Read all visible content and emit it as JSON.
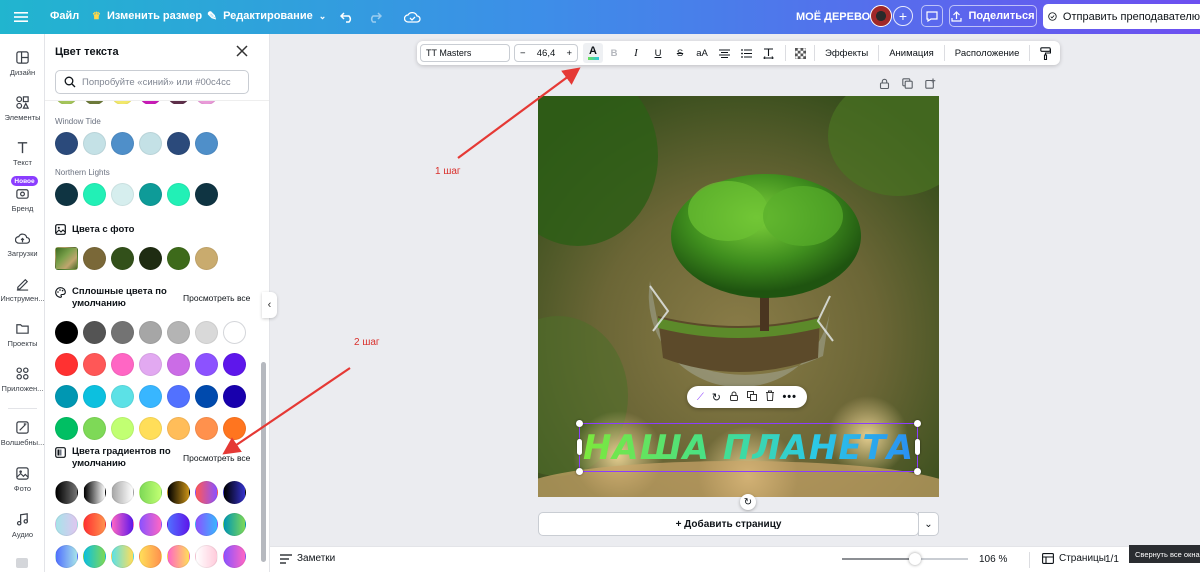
{
  "topbar": {
    "file": "Файл",
    "resize": "Изменить размер",
    "edit": "Редактирование",
    "design_name": "МОЁ ДЕРЕВО",
    "share": "Поделиться",
    "send": "Отправить преподавателю"
  },
  "rail": {
    "items": [
      {
        "label": "Дизайн",
        "icon": "layout-icon"
      },
      {
        "label": "Элементы",
        "icon": "shapes-icon"
      },
      {
        "label": "Текст",
        "icon": "text-icon"
      },
      {
        "label": "Бренд",
        "icon": "brand-icon",
        "badge": "Новое"
      },
      {
        "label": "Загрузки",
        "icon": "upload-icon"
      },
      {
        "label": "Инструмен...",
        "icon": "draw-icon"
      },
      {
        "label": "Проекты",
        "icon": "folder-icon"
      },
      {
        "label": "Приложен...",
        "icon": "apps-icon"
      },
      {
        "label": "Волшебны...",
        "icon": "magic-icon"
      },
      {
        "label": "Фото",
        "icon": "photo-icon"
      },
      {
        "label": "Аудио",
        "icon": "music-icon"
      }
    ]
  },
  "panel": {
    "title": "Цвет текста",
    "search_placeholder": "Попробуйте «синий» или #00c4cc",
    "top_partial_row": [
      "#a4c45a",
      "#6d7a3a",
      "#f2e86b",
      "#c81bb6",
      "#5e2f4a",
      "#e99ad8"
    ],
    "palettes": [
      {
        "name": "Window Tide",
        "colors": [
          "#2b4a7b",
          "#c4e1e6",
          "#4f8fc9",
          "#c4e1e6",
          "#2b4a7b",
          "#4f8fc9"
        ]
      },
      {
        "name": "Northern Lights",
        "colors": [
          "#0f3442",
          "#22f0b6",
          "#d6eeee",
          "#0e9b98",
          "#22f0b6",
          "#0f3442"
        ]
      }
    ],
    "photo_colors": {
      "title": "Цвета с фото",
      "colors": [
        "#7a6838",
        "#32501a",
        "#1f2c12",
        "#3d6a1a",
        "#c9ab6e"
      ]
    },
    "solid": {
      "title": "Сплошные цвета по умолчанию",
      "see_all": "Просмотреть все",
      "rows": [
        [
          "#000000",
          "#545454",
          "#737373",
          "#a6a6a6",
          "#b4b4b4",
          "#d9d9d9",
          "#ffffff"
        ],
        [
          "#ff3131",
          "#ff5757",
          "#ff66c4",
          "#e2a9f1",
          "#cb6ce6",
          "#8c52ff",
          "#5e17eb"
        ],
        [
          "#0097b2",
          "#0cc0df",
          "#5ce1e6",
          "#38b6ff",
          "#5271ff",
          "#004aad",
          "#1800ad"
        ],
        [
          "#00bf63",
          "#7ed957",
          "#c1ff72",
          "#ffde59",
          "#ffbd59",
          "#ff914d",
          "#ff751f"
        ]
      ]
    },
    "gradient": {
      "title": "Цвета градиентов по умолчанию",
      "see_all": "Просмотреть все",
      "rows": [
        [
          [
            "#000000",
            "#737373"
          ],
          [
            "#000000",
            "#ffffff"
          ],
          [
            "#a6a6a6",
            "#ffffff"
          ],
          [
            "#7ed957",
            "#c1ff72"
          ],
          [
            "#000000",
            "#c89116"
          ],
          [
            "#ff5757",
            "#8c52ff"
          ],
          [
            "#000000",
            "#3533cd"
          ]
        ],
        [
          [
            "#a6e3e9",
            "#dfc6f0"
          ],
          [
            "#ff3131",
            "#ff914d"
          ],
          [
            "#ff66c4",
            "#5e17eb"
          ],
          [
            "#8c52ff",
            "#ff66c4"
          ],
          [
            "#5170ff",
            "#5e17eb"
          ],
          [
            "#8c52ff",
            "#38b6ff"
          ],
          [
            "#0097b2",
            "#7ed957"
          ]
        ],
        [
          [
            "#5170ff",
            "#a6e3e9"
          ],
          [
            "#0cc0df",
            "#7ed957"
          ],
          [
            "#5ce1e6",
            "#ffde59"
          ],
          [
            "#ffde59",
            "#ff914d"
          ],
          [
            "#ff66c4",
            "#ffde59"
          ],
          [
            "#ffffff",
            "#ffcbdb"
          ],
          [
            "#8c52ff",
            "#ff66c4"
          ]
        ]
      ]
    }
  },
  "toolbar": {
    "font": "TT Masters",
    "minus": "−",
    "size": "46,4",
    "plus": "+",
    "bold": "B",
    "italic": "I",
    "underline": "U",
    "strike": "S",
    "case": "aA",
    "effects": "Эффекты",
    "animation": "Анимация",
    "position": "Расположение"
  },
  "canvas": {
    "headline": "НАША ПЛАНЕТА"
  },
  "add_page": "+ Добавить страницу",
  "bottom": {
    "notes": "Заметки",
    "zoom": "106 %",
    "pages": "Страницы",
    "page_count": "1/1",
    "tooltip": "Свернуть все окна"
  },
  "annotations": {
    "step1": "1 шаг",
    "step2": "2 шаг"
  },
  "colors": {
    "accent": "#8b3dff",
    "arrow": "#e53935"
  }
}
